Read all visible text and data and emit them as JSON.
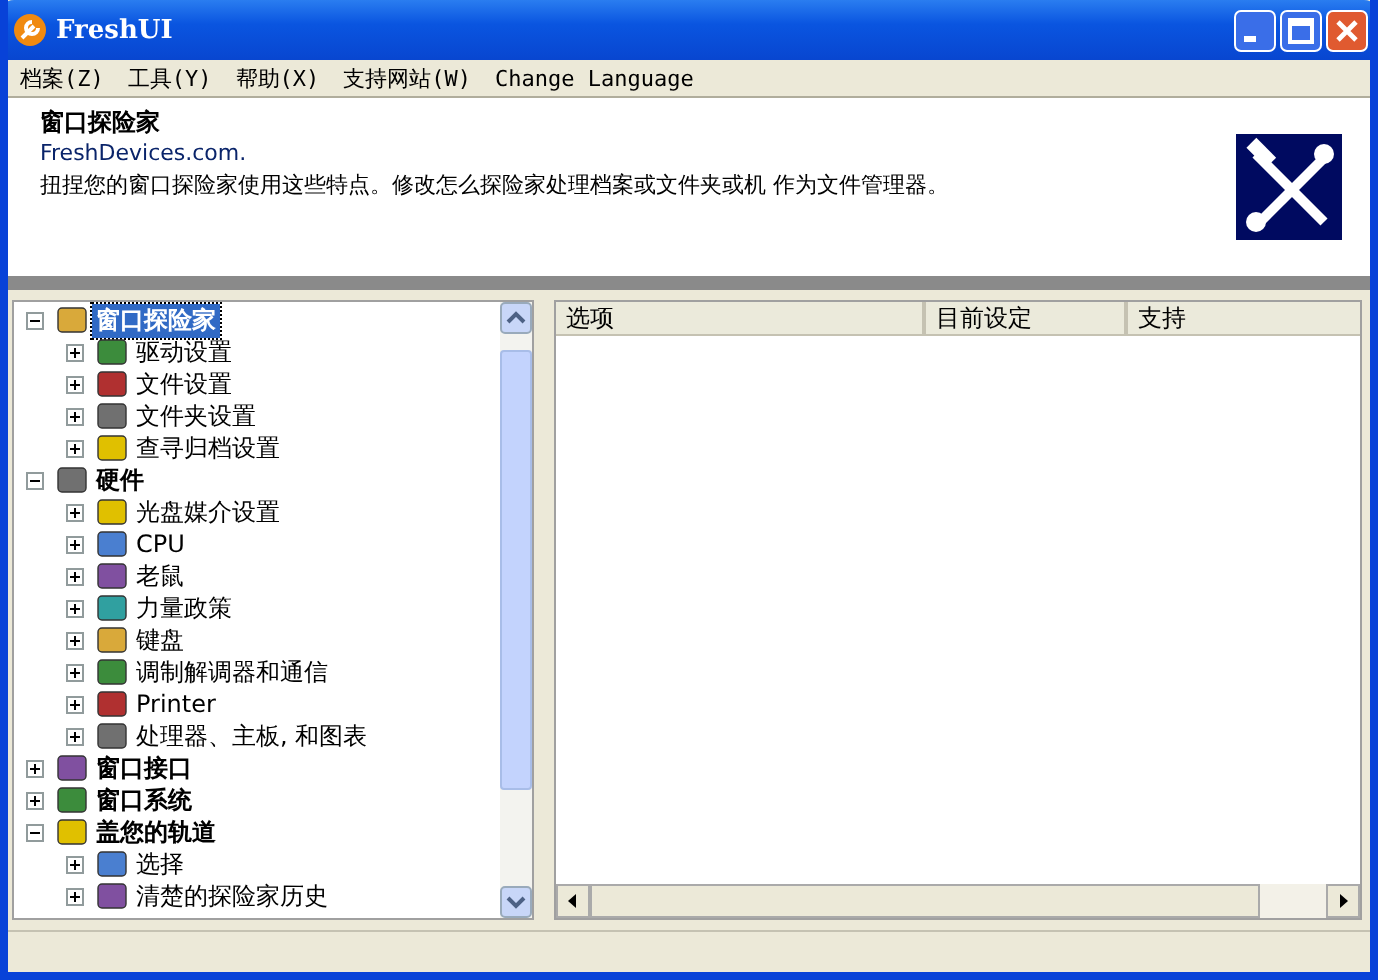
{
  "window": {
    "title": "FreshUI"
  },
  "menu": [
    "档案(Z)",
    "工具(Y)",
    "帮助(X)",
    "支持网站(W)",
    "Change Language"
  ],
  "header": {
    "title": "窗口探险家",
    "link": "FreshDevices.com.",
    "description": "扭捏您的窗口探险家使用这些特点。修改怎么探险家处理档案或文件夹或机 作为文件管理器。"
  },
  "tree": [
    {
      "label": "窗口探险家",
      "expanded": true,
      "selected": true,
      "children": [
        {
          "label": "驱动设置",
          "expanded": false,
          "selected": false
        },
        {
          "label": "文件设置",
          "expanded": false,
          "selected": false
        },
        {
          "label": "文件夹设置",
          "expanded": false,
          "selected": false
        },
        {
          "label": "查寻归档设置",
          "expanded": false,
          "selected": false
        }
      ]
    },
    {
      "label": "硬件",
      "expanded": true,
      "selected": false,
      "children": [
        {
          "label": "光盘媒介设置",
          "expanded": false,
          "selected": false
        },
        {
          "label": "CPU",
          "expanded": false,
          "selected": false
        },
        {
          "label": "老鼠",
          "expanded": false,
          "selected": false
        },
        {
          "label": "力量政策",
          "expanded": false,
          "selected": false
        },
        {
          "label": "键盘",
          "expanded": false,
          "selected": false
        },
        {
          "label": "调制解调器和通信",
          "expanded": false,
          "selected": false
        },
        {
          "label": "Printer",
          "expanded": false,
          "selected": false
        },
        {
          "label": "处理器、主板, 和图表",
          "expanded": false,
          "selected": false
        }
      ]
    },
    {
      "label": "窗口接口",
      "expanded": false,
      "selected": false
    },
    {
      "label": "窗口系统",
      "expanded": false,
      "selected": false
    },
    {
      "label": "盖您的轨道",
      "expanded": true,
      "selected": false,
      "children": [
        {
          "label": "选择",
          "expanded": false,
          "selected": false
        },
        {
          "label": "清楚的探险家历史",
          "expanded": false,
          "selected": false
        }
      ]
    }
  ],
  "list": {
    "columns": [
      "选项",
      "目前设定",
      "支持"
    ]
  }
}
